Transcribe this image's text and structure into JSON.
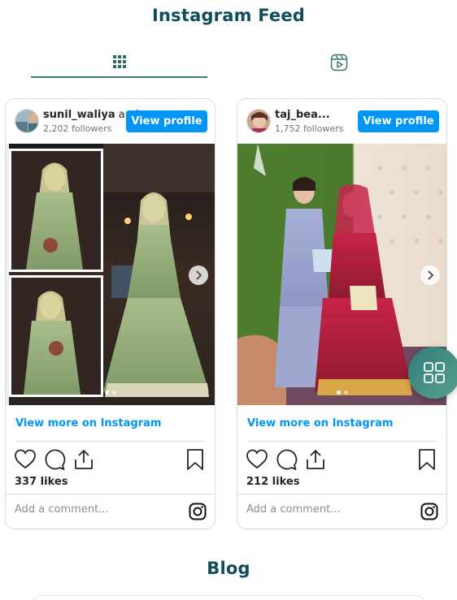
{
  "page": {
    "title": "Instagram Feed",
    "blog_title": "Blog"
  },
  "tabs": [
    {
      "icon": "grid-icon",
      "active": true
    },
    {
      "icon": "reels-icon",
      "active": false
    }
  ],
  "posts": [
    {
      "username": "sunil_waliya",
      "username_suffix": " and r",
      "followers": "2,202 followers",
      "view_profile_label": "View profile",
      "view_more_label": "View more on Instagram",
      "likes": "337 likes",
      "comment_placeholder": "Add a comment..."
    },
    {
      "username": "taj_bea...",
      "username_suffix": "",
      "followers": "1,752 followers",
      "view_profile_label": "View profile",
      "view_more_label": "View more on Instagram",
      "likes": "212 likes",
      "comment_placeholder": "Add a comment..."
    }
  ],
  "colors": {
    "heading": "#0f4c5c",
    "primary_button": "#0095f6",
    "tab_underline": "#3d7a70",
    "fab": "#2f7c7c"
  }
}
